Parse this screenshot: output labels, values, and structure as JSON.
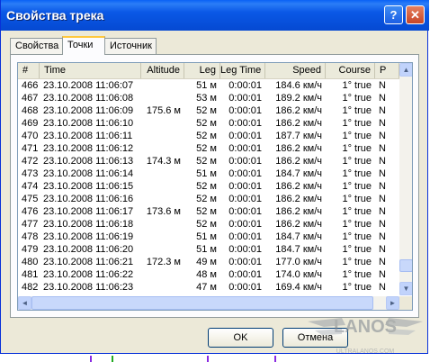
{
  "window": {
    "title": "Свойства трека"
  },
  "title_buttons": {
    "help": "?",
    "close": "✕"
  },
  "tabs": [
    {
      "label": "Свойства",
      "active": false
    },
    {
      "label": "Точки",
      "active": true
    },
    {
      "label": "Источник",
      "active": false
    }
  ],
  "table": {
    "columns": [
      "#",
      "Time",
      "Altitude",
      "Leg",
      "Leg Time",
      "Speed",
      "Course",
      "P"
    ],
    "rows": [
      [
        "466",
        "23.10.2008 11:06:07",
        "",
        "51 м",
        "0:00:01",
        "184.6 км/ч",
        "1° true",
        "N"
      ],
      [
        "467",
        "23.10.2008 11:06:08",
        "",
        "53 м",
        "0:00:01",
        "189.2 км/ч",
        "1° true",
        "N"
      ],
      [
        "468",
        "23.10.2008 11:06:09",
        "175.6 м",
        "52 м",
        "0:00:01",
        "186.2 км/ч",
        "1° true",
        "N"
      ],
      [
        "469",
        "23.10.2008 11:06:10",
        "",
        "52 м",
        "0:00:01",
        "186.2 км/ч",
        "1° true",
        "N"
      ],
      [
        "470",
        "23.10.2008 11:06:11",
        "",
        "52 м",
        "0:00:01",
        "187.7 км/ч",
        "1° true",
        "N"
      ],
      [
        "471",
        "23.10.2008 11:06:12",
        "",
        "52 м",
        "0:00:01",
        "186.2 км/ч",
        "1° true",
        "N"
      ],
      [
        "472",
        "23.10.2008 11:06:13",
        "174.3 м",
        "52 м",
        "0:00:01",
        "186.2 км/ч",
        "1° true",
        "N"
      ],
      [
        "473",
        "23.10.2008 11:06:14",
        "",
        "51 м",
        "0:00:01",
        "184.7 км/ч",
        "1° true",
        "N"
      ],
      [
        "474",
        "23.10.2008 11:06:15",
        "",
        "52 м",
        "0:00:01",
        "186.2 км/ч",
        "1° true",
        "N"
      ],
      [
        "475",
        "23.10.2008 11:06:16",
        "",
        "52 м",
        "0:00:01",
        "186.2 км/ч",
        "1° true",
        "N"
      ],
      [
        "476",
        "23.10.2008 11:06:17",
        "173.6 м",
        "52 м",
        "0:00:01",
        "186.2 км/ч",
        "1° true",
        "N"
      ],
      [
        "477",
        "23.10.2008 11:06:18",
        "",
        "52 м",
        "0:00:01",
        "186.2 км/ч",
        "1° true",
        "N"
      ],
      [
        "478",
        "23.10.2008 11:06:19",
        "",
        "51 м",
        "0:00:01",
        "184.7 км/ч",
        "1° true",
        "N"
      ],
      [
        "479",
        "23.10.2008 11:06:20",
        "",
        "51 м",
        "0:00:01",
        "184.7 км/ч",
        "1° true",
        "N"
      ],
      [
        "480",
        "23.10.2008 11:06:21",
        "172.3 м",
        "49 м",
        "0:00:01",
        "177.0 км/ч",
        "1° true",
        "N"
      ],
      [
        "481",
        "23.10.2008 11:06:22",
        "",
        "48 м",
        "0:00:01",
        "174.0 км/ч",
        "1° true",
        "N"
      ],
      [
        "482",
        "23.10.2008 11:06:23",
        "",
        "47 м",
        "0:00:01",
        "169.4 км/ч",
        "1° true",
        "N"
      ]
    ]
  },
  "scrollbars": {
    "up": "▲",
    "down": "▼",
    "left": "◄",
    "right": "►"
  },
  "buttons": {
    "ok": "OK",
    "cancel": "Отмена"
  },
  "watermark": {
    "text": "LANOS",
    "subtext": "ULTRALANOS.COM"
  },
  "colors": {
    "titlebar": "#0a58e6",
    "close": "#c74527",
    "tab_highlight": "#ffc83c"
  }
}
